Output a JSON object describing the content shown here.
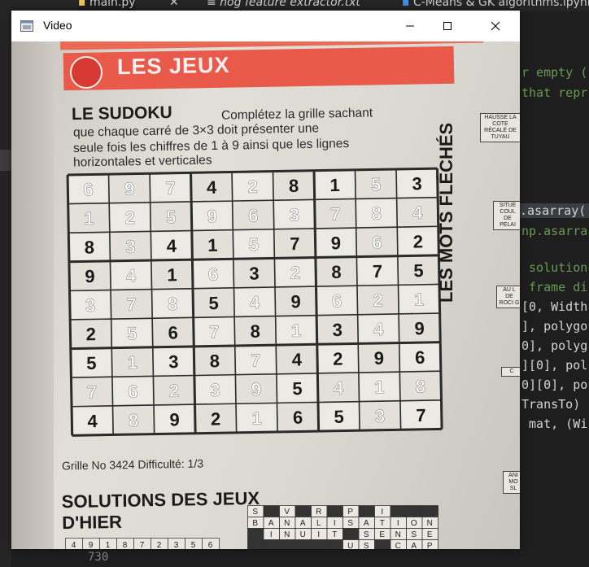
{
  "ide": {
    "tabs": [
      {
        "label": "main.py",
        "active": true
      },
      {
        "label": "hog feature extractor.txt",
        "active": false
      },
      {
        "label": "C-Means & GK algorithms.ipynb",
        "active": false
      }
    ],
    "code_lines": [
      {
        "text": "r empty (",
        "kind": "comment"
      },
      {
        "text": "that repr",
        "kind": "comment"
      },
      {
        "text": ".asarray(",
        "kind": "hl"
      },
      {
        "text": "np.asarra",
        "kind": "comment"
      },
      {
        "text": " solution",
        "kind": "comment"
      },
      {
        "text": " frame di",
        "kind": "comment"
      },
      {
        "text": "[0, Width",
        "kind": "code"
      },
      {
        "text": "], polygo",
        "kind": "code"
      },
      {
        "text": "0], polyg",
        "kind": "code"
      },
      {
        "text": "][0], pol",
        "kind": "code"
      },
      {
        "text": "0][0], po",
        "kind": "code"
      },
      {
        "text": "TransTo)",
        "kind": "code"
      },
      {
        "text": " mat, (Wi",
        "kind": "code"
      }
    ],
    "line_number": "730"
  },
  "window": {
    "title": "Video",
    "minimize_label": "Minimize",
    "maximize_label": "Maximize",
    "close_label": "Close"
  },
  "newspaper": {
    "banner": "LES JEUX",
    "heading": "LE SUDOKU",
    "intro_lines": [
      "Complétez la grille sachant",
      "que chaque carré de 3×3 doit présenter une",
      "seule fois les chiffres de 1 à 9 ainsi que les lignes",
      "horizontales et verticales"
    ],
    "grid": [
      [
        6,
        9,
        7,
        4,
        2,
        8,
        1,
        5,
        3
      ],
      [
        1,
        2,
        5,
        9,
        6,
        3,
        7,
        8,
        4
      ],
      [
        8,
        3,
        4,
        1,
        5,
        7,
        9,
        6,
        2
      ],
      [
        9,
        4,
        1,
        6,
        3,
        2,
        8,
        7,
        5
      ],
      [
        3,
        7,
        8,
        5,
        4,
        9,
        6,
        2,
        1
      ],
      [
        2,
        5,
        6,
        7,
        8,
        1,
        3,
        4,
        9
      ],
      [
        5,
        1,
        3,
        8,
        7,
        4,
        2,
        9,
        6
      ],
      [
        7,
        6,
        2,
        3,
        9,
        5,
        4,
        1,
        8
      ],
      [
        4,
        8,
        9,
        2,
        1,
        6,
        5,
        3,
        7
      ]
    ],
    "overlay_cells": [
      [
        0,
        0
      ],
      [
        0,
        1
      ],
      [
        0,
        2
      ],
      [
        0,
        4
      ],
      [
        0,
        7
      ],
      [
        1,
        0
      ],
      [
        1,
        1
      ],
      [
        1,
        2
      ],
      [
        1,
        3
      ],
      [
        1,
        4
      ],
      [
        1,
        5
      ],
      [
        1,
        6
      ],
      [
        1,
        7
      ],
      [
        1,
        8
      ],
      [
        2,
        1
      ],
      [
        2,
        4
      ],
      [
        2,
        7
      ],
      [
        3,
        1
      ],
      [
        3,
        3
      ],
      [
        3,
        5
      ],
      [
        4,
        0
      ],
      [
        4,
        1
      ],
      [
        4,
        2
      ],
      [
        4,
        4
      ],
      [
        4,
        6
      ],
      [
        4,
        7
      ],
      [
        4,
        8
      ],
      [
        5,
        1
      ],
      [
        5,
        3
      ],
      [
        5,
        5
      ],
      [
        5,
        7
      ],
      [
        6,
        1
      ],
      [
        6,
        4
      ],
      [
        7,
        0
      ],
      [
        7,
        1
      ],
      [
        7,
        2
      ],
      [
        7,
        3
      ],
      [
        7,
        4
      ],
      [
        7,
        6
      ],
      [
        7,
        7
      ],
      [
        7,
        8
      ],
      [
        8,
        1
      ],
      [
        8,
        4
      ],
      [
        8,
        7
      ]
    ],
    "grille_label": "Grille No 3424  Difficulté: 1/3",
    "solutions_title_line1": "SOLUTIONS  DES JEUX",
    "solutions_title_line2": "D'HIER",
    "side_title": "LES MOTS FLÉCHÉS",
    "side_clues": [
      "HAUSSE LA COTE RÉCALÉ DE TUYAU",
      "SITUE COUL DE PELAI",
      "AU L DE ROCI G",
      "C",
      "ANI MO SL"
    ],
    "mini_letters": [
      [
        "S",
        "",
        "V",
        "",
        "R",
        "",
        "P",
        "",
        "I",
        ""
      ],
      [
        "B",
        "A",
        "N",
        "A",
        "L",
        "I",
        "S",
        "A",
        "T",
        "I",
        "O",
        "N"
      ],
      [
        "",
        "I",
        "N",
        "U",
        "I",
        "T",
        "",
        "S",
        "E",
        "N",
        "S",
        "E"
      ],
      [
        "",
        "",
        "",
        "",
        "",
        "",
        "U",
        "S",
        "",
        "C",
        "A",
        "P"
      ]
    ],
    "bottom_numbers": [
      "4",
      "9",
      "1",
      "8",
      "7",
      "2",
      "3",
      "5",
      "6"
    ]
  },
  "colors": {
    "overlay_digit": "#ffffff",
    "print_digit": "#1a1a1a",
    "banner_red": "#ea5a4a"
  }
}
